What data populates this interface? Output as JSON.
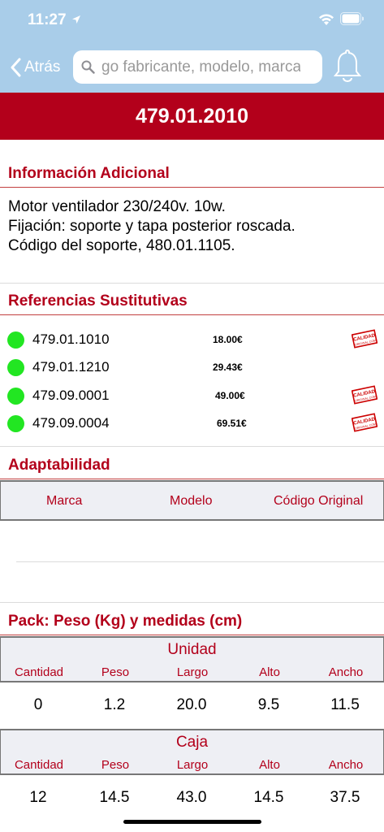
{
  "status": {
    "time": "11:27"
  },
  "nav": {
    "back_label": "Atrás",
    "search_placeholder": "go fabricante, modelo, marca"
  },
  "title": "479.01.2010",
  "info": {
    "header": "Información Adicional",
    "lines": [
      "Motor ventilador 230/240v. 10w.",
      "Fijación: soporte y tapa posterior roscada.",
      "Código del soporte, 480.01.1105."
    ]
  },
  "references": {
    "header": "Referencias Sustitutivas",
    "items": [
      {
        "code": "479.01.1010",
        "price": "18.00€",
        "badge": true
      },
      {
        "code": "479.01.1210",
        "price": "29.43€",
        "badge": false
      },
      {
        "code": "479.09.0001",
        "price": "49.00€",
        "badge": true
      },
      {
        "code": "479.09.0004",
        "price": "69.51€",
        "badge": true
      }
    ],
    "badge_text_1": "CALIDAD",
    "badge_text_2": "ORIGINAL.COM"
  },
  "adapt": {
    "header": "Adaptabilidad",
    "columns": [
      "Marca",
      "Modelo",
      "Código Original"
    ]
  },
  "pack": {
    "header": "Pack: Peso (Kg) y medidas (cm)",
    "columns": [
      "Cantidad",
      "Peso",
      "Largo",
      "Alto",
      "Ancho"
    ],
    "groups": [
      {
        "title": "Unidad",
        "values": [
          "0",
          "1.2",
          "20.0",
          "9.5",
          "11.5"
        ]
      },
      {
        "title": "Caja",
        "values": [
          "12",
          "14.5",
          "43.0",
          "14.5",
          "37.5"
        ]
      }
    ]
  },
  "colors": {
    "topbar": "#a9cde9",
    "brand_red": "#b3001b",
    "dot_green": "#22e622"
  }
}
